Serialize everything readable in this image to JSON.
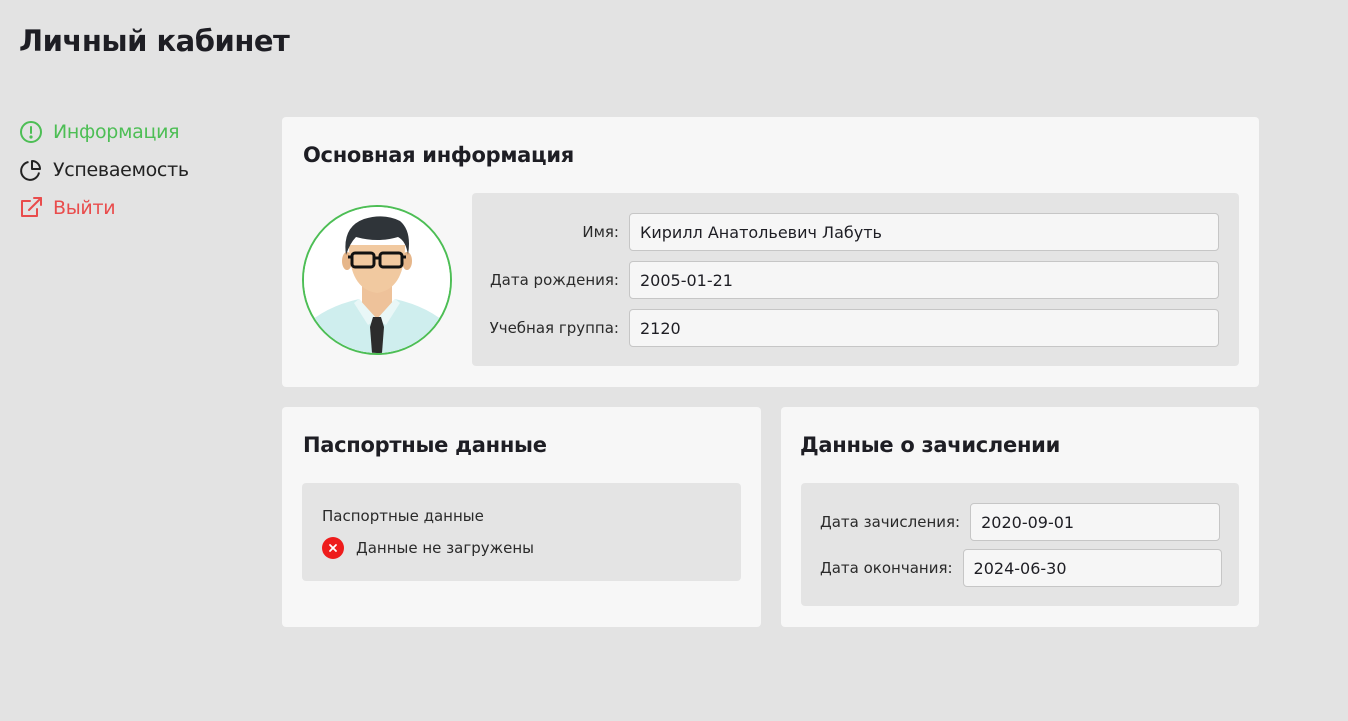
{
  "page": {
    "title": "Личный кабинет"
  },
  "sidebar": {
    "items": [
      {
        "label": "Информация",
        "icon": "info-circle-icon",
        "state": "active",
        "color": "#4dbe55"
      },
      {
        "label": "Успеваемость",
        "icon": "pie-chart-icon",
        "state": "default",
        "color": "#222222"
      },
      {
        "label": "Выйти",
        "icon": "external-link-icon",
        "state": "danger",
        "color": "#e94c4c"
      }
    ]
  },
  "main_info": {
    "title": "Основная информация",
    "avatar_icon": "user-avatar-icon",
    "fields": [
      {
        "label": "Имя:",
        "value": "Кирилл Анатольевич Лабуть"
      },
      {
        "label": "Дата рождения:",
        "value": "2005-01-21"
      },
      {
        "label": "Учебная группа:",
        "value": "2120"
      }
    ]
  },
  "passport": {
    "title": "Паспортные данные",
    "label": "Паспортные данные",
    "status_text": "Данные не загружены",
    "status_icon": "error-x-icon",
    "status_color": "#ee1c1c"
  },
  "enrollment": {
    "title": "Данные о зачислении",
    "fields": [
      {
        "label": "Дата зачисления:",
        "value": "2020-09-01"
      },
      {
        "label": "Дата окончания:",
        "value": "2024-06-30"
      }
    ]
  },
  "colors": {
    "accent": "#4dbe55",
    "danger": "#e94c4c",
    "background": "#e3e3e3",
    "card": "#f7f7f7"
  }
}
